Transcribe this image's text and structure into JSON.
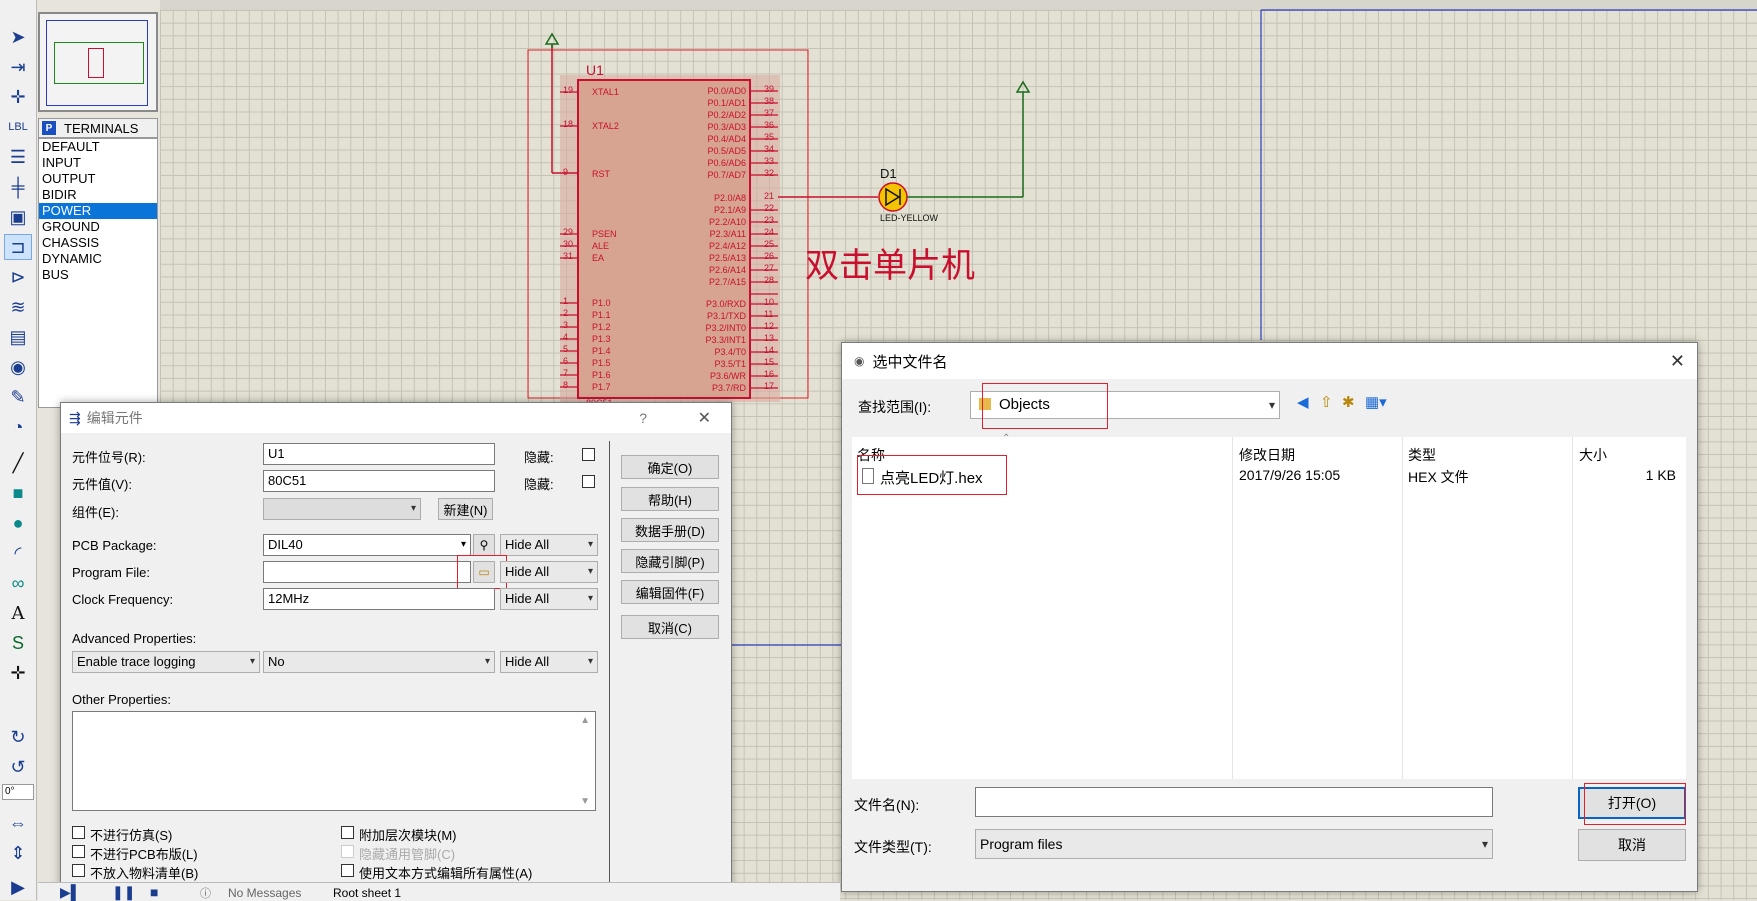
{
  "toolbar": {
    "angle": "0°"
  },
  "object_selector": {
    "badge": "P",
    "title": "TERMINALS",
    "items": [
      "DEFAULT",
      "INPUT",
      "OUTPUT",
      "BIDIR",
      "POWER",
      "GROUND",
      "CHASSIS",
      "DYNAMIC",
      "BUS"
    ],
    "selected": "POWER"
  },
  "schematic": {
    "chip_ref": "U1",
    "chip_part": "80C51",
    "left_pins": [
      {
        "num": "19",
        "name": "XTAL1"
      },
      {
        "num": "18",
        "name": "XTAL2"
      },
      {
        "num": "9",
        "name": "RST"
      },
      {
        "num": "29",
        "name": "PSEN"
      },
      {
        "num": "30",
        "name": "ALE"
      },
      {
        "num": "31",
        "name": "EA"
      },
      {
        "num": "1",
        "name": "P1.0"
      },
      {
        "num": "2",
        "name": "P1.1"
      },
      {
        "num": "3",
        "name": "P1.2"
      },
      {
        "num": "4",
        "name": "P1.3"
      },
      {
        "num": "5",
        "name": "P1.4"
      },
      {
        "num": "6",
        "name": "P1.5"
      },
      {
        "num": "7",
        "name": "P1.6"
      },
      {
        "num": "8",
        "name": "P1.7"
      }
    ],
    "right_pins": [
      {
        "num": "39",
        "name": "P0.0/AD0"
      },
      {
        "num": "38",
        "name": "P0.1/AD1"
      },
      {
        "num": "37",
        "name": "P0.2/AD2"
      },
      {
        "num": "36",
        "name": "P0.3/AD3"
      },
      {
        "num": "35",
        "name": "P0.4/AD4"
      },
      {
        "num": "34",
        "name": "P0.5/AD5"
      },
      {
        "num": "33",
        "name": "P0.6/AD6"
      },
      {
        "num": "32",
        "name": "P0.7/AD7"
      },
      {
        "num": "21",
        "name": "P2.0/A8"
      },
      {
        "num": "22",
        "name": "P2.1/A9"
      },
      {
        "num": "23",
        "name": "P2.2/A10"
      },
      {
        "num": "24",
        "name": "P2.3/A11"
      },
      {
        "num": "25",
        "name": "P2.4/A12"
      },
      {
        "num": "26",
        "name": "P2.5/A13"
      },
      {
        "num": "27",
        "name": "P2.6/A14"
      },
      {
        "num": "28",
        "name": "P2.7/A15"
      },
      {
        "num": "10",
        "name": "P3.0/RXD"
      },
      {
        "num": "11",
        "name": "P3.1/TXD"
      },
      {
        "num": "12",
        "name": "P3.2/INT0"
      },
      {
        "num": "13",
        "name": "P3.3/INT1"
      },
      {
        "num": "14",
        "name": "P3.4/T0"
      },
      {
        "num": "15",
        "name": "P3.5/T1"
      },
      {
        "num": "16",
        "name": "P3.6/WR"
      },
      {
        "num": "17",
        "name": "P3.7/RD"
      }
    ],
    "led_ref": "D1",
    "led_part": "LED-YELLOW",
    "annotation": "双击单片机"
  },
  "edit_dialog": {
    "title": "编辑元件",
    "help": "?",
    "close": "✕",
    "ref_label": "元件位号(R):",
    "ref_value": "U1",
    "hidden1": "隐藏:",
    "val_label": "元件值(V):",
    "val_value": "80C51",
    "hidden2": "隐藏:",
    "group_label": "组件(E):",
    "new_btn": "新建(N)",
    "pcb_label": "PCB Package:",
    "pcb_value": "DIL40",
    "pcb_hide": "Hide All",
    "prog_label": "Program File:",
    "prog_value": "",
    "prog_hide": "Hide All",
    "clock_label": "Clock Frequency:",
    "clock_value": "12MHz",
    "clock_hide": "Hide All",
    "adv_label": "Advanced Properties:",
    "adv_prop": "Enable trace logging",
    "adv_value": "No",
    "adv_hide": "Hide All",
    "other_label": "Other Properties:",
    "buttons": [
      "确定(O)",
      "帮助(H)",
      "数据手册(D)",
      "隐藏引脚(P)",
      "编辑固件(F)",
      "取消(C)"
    ],
    "checks": [
      "不进行仿真(S)",
      "不进行PCB布版(L)",
      "不放入物料清单(B)",
      "附加层次模块(M)",
      "隐藏通用管脚(C)",
      "使用文本方式编辑所有属性(A)"
    ]
  },
  "file_dialog": {
    "title": "选中文件名",
    "close": "✕",
    "lookin_label": "查找范围(I):",
    "lookin_value": "Objects",
    "columns": [
      "名称",
      "修改日期",
      "类型",
      "大小"
    ],
    "files": [
      {
        "name": "点亮LED灯.hex",
        "date": "2017/9/26 15:05",
        "type": "HEX 文件",
        "size": "1 KB"
      }
    ],
    "filename_label": "文件名(N):",
    "filename_value": "",
    "filetype_label": "文件类型(T):",
    "filetype_value": "Program files",
    "open_btn": "打开(O)",
    "cancel_btn": "取消"
  },
  "statusbar": {
    "messages": "No Messages",
    "sheet": "Root sheet 1"
  }
}
